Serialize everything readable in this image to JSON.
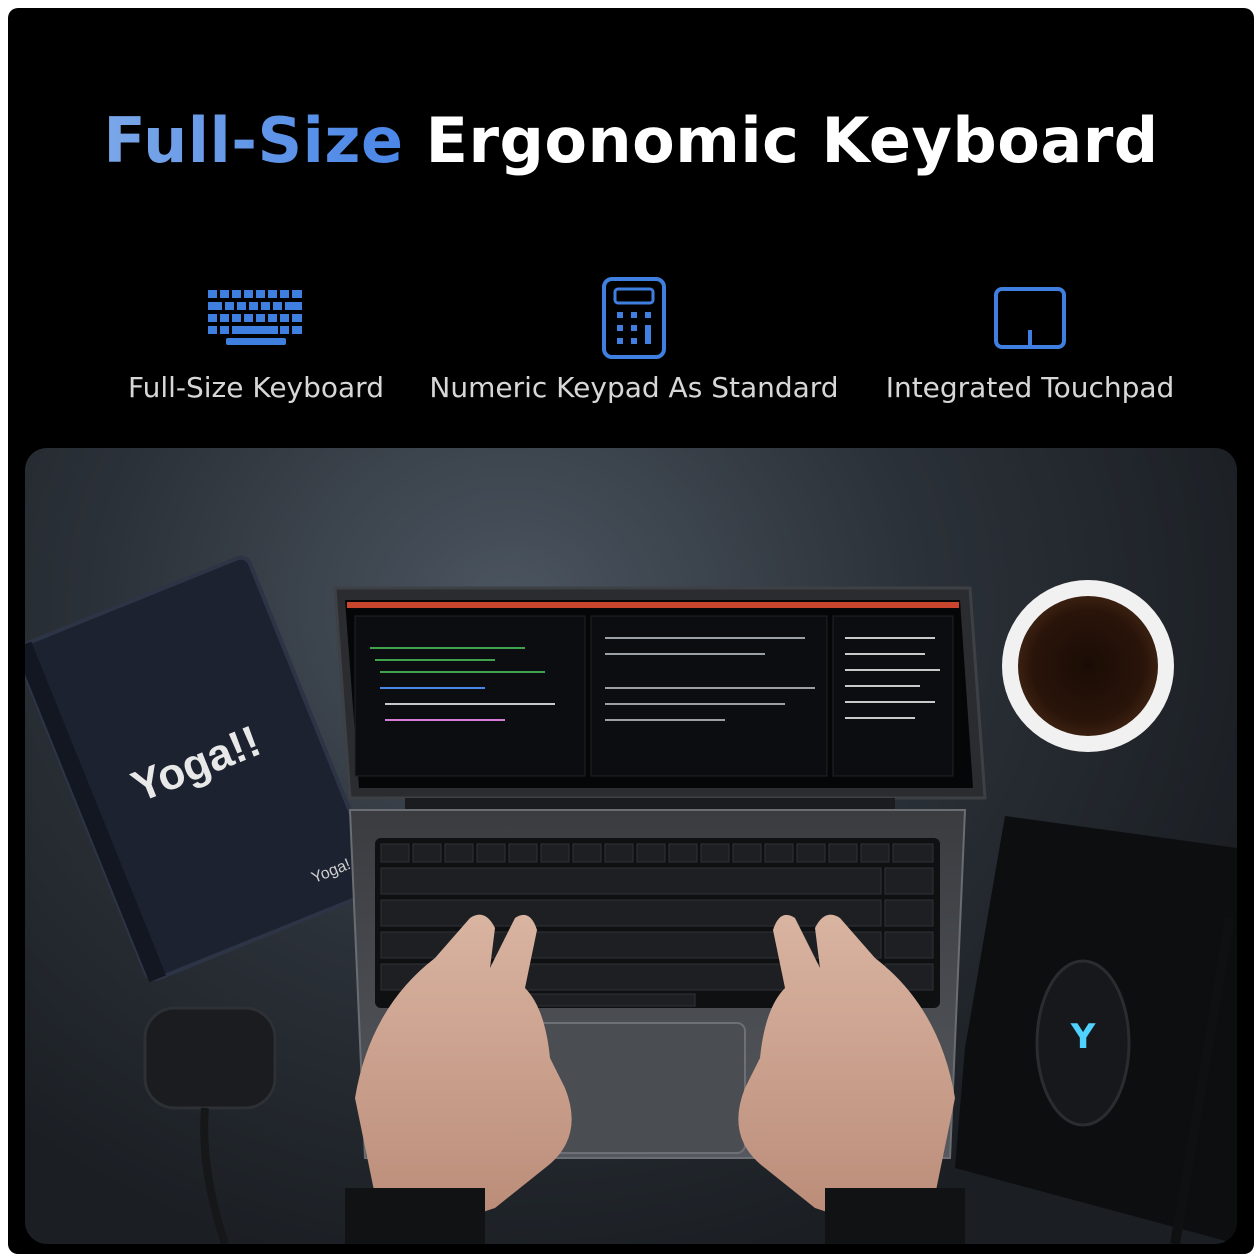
{
  "title": {
    "accent": "Full-Size",
    "rest": "Ergonomic Keyboard"
  },
  "features": [
    {
      "icon": "keyboard-icon",
      "label": "Full-Size Keyboard"
    },
    {
      "icon": "calculator-icon",
      "label": "Numeric Keypad As Standard"
    },
    {
      "icon": "touchpad-icon",
      "label": "Integrated Touchpad"
    }
  ],
  "photo": {
    "notebook_brand": "Yoga!!",
    "notebook_small_brand": "Yoga!"
  },
  "colors": {
    "accent": "#4a86e8",
    "background": "#000000",
    "label": "#d7d7d7"
  }
}
